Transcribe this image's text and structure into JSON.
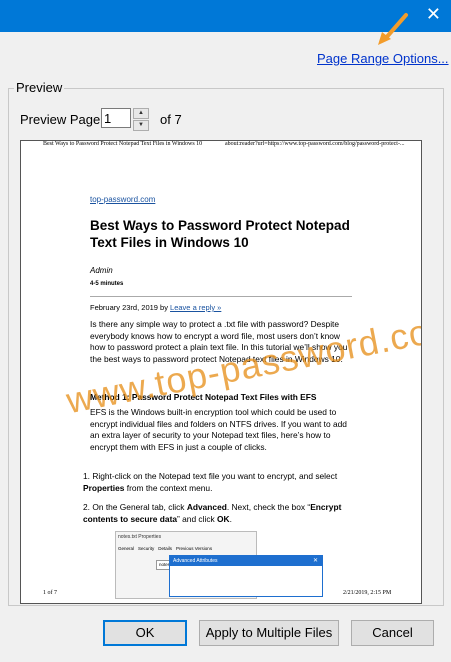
{
  "window": {
    "close_glyph": "✕",
    "title_color": "#0078d7"
  },
  "page_range_options": "Page Range Options...",
  "preview": {
    "group_label": "Preview",
    "page_label": "Preview Page",
    "current_page": "1",
    "of_label": "of 7"
  },
  "document": {
    "header_left": "Best Ways to Password Protect Notepad Text Files in Windows 10",
    "header_right": "about:reader?url=https://www.top-password.com/blog/password-protect-...",
    "site": "top-password.com",
    "title": "Best Ways to Password Protect Notepad Text Files in Windows 10",
    "author": "Admin",
    "read_time": "4-5 minutes",
    "date": "February 23rd, 2019 by ",
    "reply_link": "Leave a reply »",
    "para1": "Is there any simple way to protect a .txt file with password? Despite everybody knows how to encrypt a word file, most users don’t know how to password protect a plain text file. In this tutorial we’ll show you the best ways to password protect Notepad text files in Windows 10.",
    "method1": "Method 1: Password Protect Notepad Text Files with EFS",
    "para2": "EFS is the Windows built-in encryption tool which could be used to encrypt individual files and folders on NTFS drives. If you want to add an extra layer of security to your Notepad text files, here’s how to encrypt them with EFS in just a couple of clicks.",
    "step1_num": "1.",
    "step1_pre": "Right-click on the Notepad text file you want to encrypt, and select ",
    "step1_bold": "Properties",
    "step1_post": " from the context menu.",
    "step2_num": "2.",
    "step2_a": "On the General tab, click ",
    "step2_b": "Advanced",
    "step2_c": ". Next, check the box “",
    "step2_d": "Encrypt contents to secure data",
    "step2_e": "” and click ",
    "step2_f": "OK",
    "step2_g": ".",
    "shot_title": "notes.txt Properties",
    "shot_tabs": [
      "General",
      "Security",
      "Details",
      "Previous Versions"
    ],
    "shot_filename": "notes.txt",
    "adv_title": "Advanced Attributes",
    "adv_close": "✕",
    "footer_left": "1 of 7",
    "footer_right": "2/21/2019, 2:15 PM",
    "watermark": "www.top-password.com"
  },
  "buttons": {
    "ok": "OK",
    "apply": "Apply to Multiple Files",
    "cancel": "Cancel"
  },
  "colors": {
    "accent": "#0078d7",
    "arrow": "#f39c2a",
    "link": "#0033cc"
  }
}
